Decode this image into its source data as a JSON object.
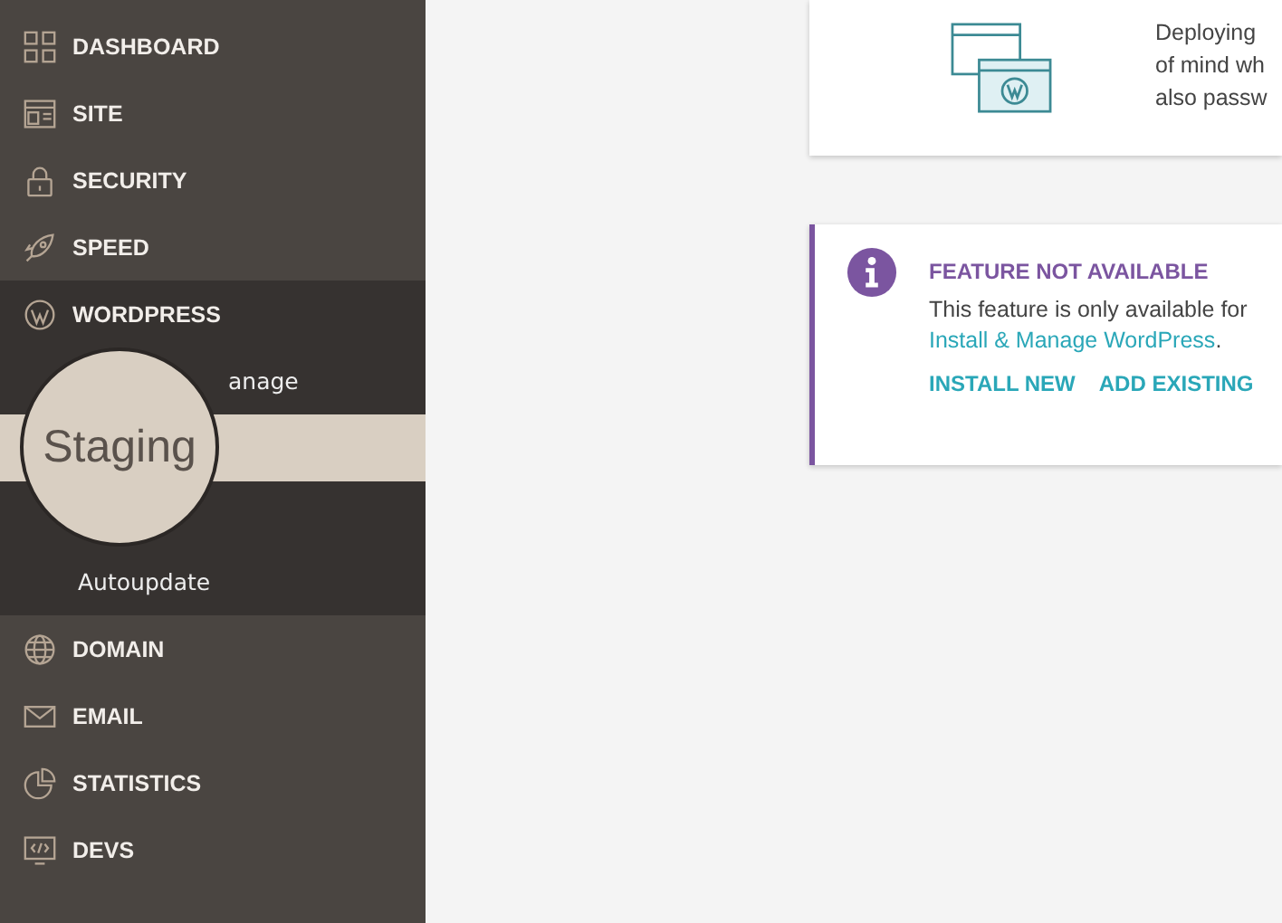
{
  "sidebar": {
    "items": [
      {
        "label": "DASHBOARD",
        "kind": "dashboard",
        "expanded": false
      },
      {
        "label": "SITE",
        "kind": "site",
        "expanded": false
      },
      {
        "label": "SECURITY",
        "kind": "security",
        "expanded": false
      },
      {
        "label": "SPEED",
        "kind": "speed",
        "expanded": false
      },
      {
        "label": "WORDPRESS",
        "kind": "wordpress",
        "expanded": true,
        "children": [
          {
            "label": "anage",
            "selected": false
          },
          {
            "label": "Staging",
            "selected": true
          },
          {
            "label": "Autoupdate",
            "selected": false
          }
        ]
      },
      {
        "label": "DOMAIN",
        "kind": "domain",
        "expanded": false
      },
      {
        "label": "EMAIL",
        "kind": "email",
        "expanded": false
      },
      {
        "label": "STATISTICS",
        "kind": "statistics",
        "expanded": false
      },
      {
        "label": "DEVS",
        "kind": "devs",
        "expanded": false
      }
    ]
  },
  "info_card": {
    "lines": [
      "Deploying",
      "of mind wh",
      "also passw"
    ]
  },
  "notice": {
    "title": "FEATURE NOT AVAILABLE",
    "text": "This feature is only available for",
    "link": "Install & Manage WordPress",
    "link_suffix": ".",
    "actions": [
      "INSTALL NEW",
      "ADD EXISTING"
    ]
  }
}
